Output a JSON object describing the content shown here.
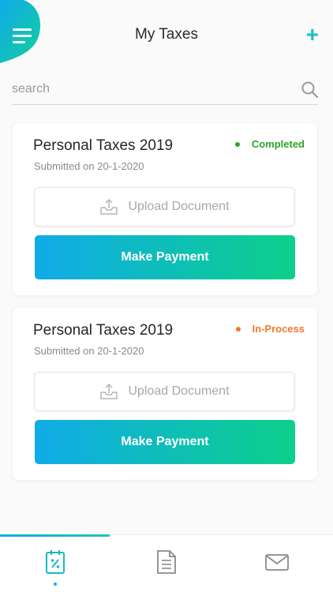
{
  "header": {
    "title": "My Taxes",
    "add_label": "+"
  },
  "search": {
    "placeholder": "search"
  },
  "cards": [
    {
      "title": "Personal Taxes 2019",
      "submitted": "Submitted on 20-1-2020",
      "status": "Completed",
      "status_color": "#2aa52a",
      "upload_label": "Upload Document",
      "pay_label": "Make Payment"
    },
    {
      "title": "Personal Taxes 2019",
      "submitted": "Submitted on 20-1-2020",
      "status": "In-Process",
      "status_color": "#f07a2a",
      "upload_label": "Upload Document",
      "pay_label": "Make Payment"
    }
  ],
  "bottom_nav": {
    "items": [
      {
        "icon": "tax-calendar-icon",
        "active": true
      },
      {
        "icon": "document-icon",
        "active": false
      },
      {
        "icon": "mail-icon",
        "active": false
      }
    ]
  },
  "colors": {
    "accent": "#10abe8",
    "gradient_end": "#0dd08a",
    "completed": "#2aa52a",
    "in_process": "#f07a2a"
  }
}
